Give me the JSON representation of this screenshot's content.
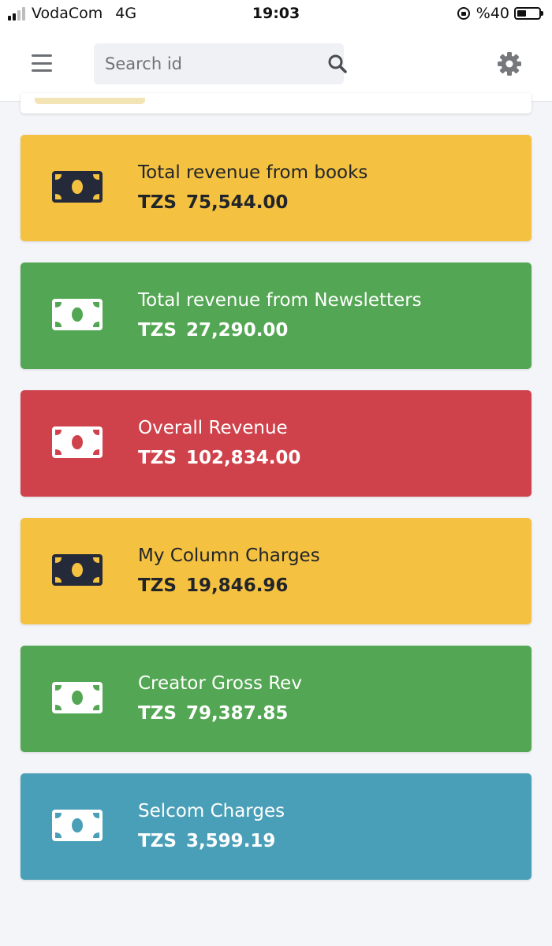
{
  "status_bar": {
    "carrier": "VodaCom",
    "network": "4G",
    "time": "19:03",
    "battery": "%40"
  },
  "header": {
    "search": {
      "placeholder": "Search id",
      "value": ""
    },
    "icons": {
      "menu": "hamburger-menu-icon",
      "search": "search-icon",
      "settings": "gear-icon"
    }
  },
  "colors": {
    "warning": "#f4c141",
    "success": "#53a653",
    "danger": "#cf424b",
    "info": "#4a9fb8",
    "background": "#f4f5f9"
  },
  "cards": [
    {
      "label": "Total revenue from books",
      "currency": "TZS",
      "amount": "75,544.00",
      "theme": "warning",
      "icon": "money-bill-icon"
    },
    {
      "label": "Total revenue from Newsletters",
      "currency": "TZS",
      "amount": "27,290.00",
      "theme": "success",
      "icon": "money-bill-icon"
    },
    {
      "label": "Overall Revenue",
      "currency": "TZS",
      "amount": "102,834.00",
      "theme": "danger",
      "icon": "money-bill-icon"
    },
    {
      "label": "My Column Charges",
      "currency": "TZS",
      "amount": "19,846.96",
      "theme": "warning",
      "icon": "money-bill-icon"
    },
    {
      "label": "Creator Gross Rev",
      "currency": "TZS",
      "amount": "79,387.85",
      "theme": "success",
      "icon": "money-bill-icon"
    },
    {
      "label": "Selcom Charges",
      "currency": "TZS",
      "amount": "3,599.19",
      "theme": "info",
      "icon": "money-bill-icon"
    }
  ]
}
